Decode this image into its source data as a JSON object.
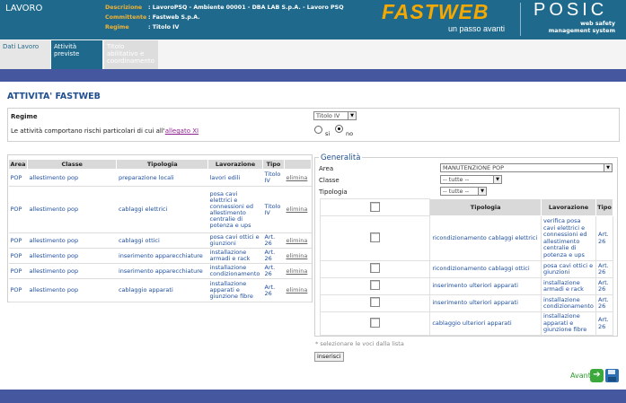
{
  "header": {
    "section_title": "LAVORO",
    "descrizione_label": "Descrizione",
    "descrizione_value": ": LavoroPSQ - Ambiente 00001 - DBA LAB S.p.A. - Lavoro PSQ",
    "committente_label": "Committente",
    "committente_value": ": Fastweb S.p.A.",
    "regime_label": "Regime",
    "regime_value": ": Titolo IV",
    "brand_logo": "FASTWEB",
    "brand_tagline": "un passo avanti",
    "product_logo": "POSIC",
    "product_tagline_1": "web safety",
    "product_tagline_2": "management system"
  },
  "tabs": [
    {
      "label": "Dati Lavoro"
    },
    {
      "label": "Attività previste"
    },
    {
      "label": "Titolo abilitativo e coordinamento"
    }
  ],
  "page": {
    "title": "ATTIVITA' FASTWEB",
    "regime_label": "Regime",
    "regime_select": "Titolo IV",
    "allegato_text": "Le attività comportano rischi particolari di cui all'",
    "allegato_link": "allegato XI",
    "radio_si": "si",
    "radio_no": "no"
  },
  "left_table": {
    "headers": [
      "Area",
      "Classe",
      "Tipologia",
      "Lavorazione",
      "Tipo",
      ""
    ],
    "rows": [
      {
        "area": "POP",
        "classe": "allestimento pop",
        "tipologia": "preparazione locali",
        "lavorazione": "lavori edili",
        "tipo": "Titolo IV",
        "action": "elimina"
      },
      {
        "area": "POP",
        "classe": "allestimento pop",
        "tipologia": "cablaggi elettrici",
        "lavorazione": "posa cavi elettrici e connessioni ed allestimento centralie di potenza e ups",
        "tipo": "Titolo IV",
        "action": "elimina"
      },
      {
        "area": "POP",
        "classe": "allestimento pop",
        "tipologia": "cablaggi ottici",
        "lavorazione": "posa cavi ottici e giunzioni",
        "tipo": "Art. 26",
        "action": "elimina"
      },
      {
        "area": "POP",
        "classe": "allestimento pop",
        "tipologia": "inserimento apparecchiature",
        "lavorazione": "installazione armadi e rack",
        "tipo": "Art. 26",
        "action": "elimina"
      },
      {
        "area": "POP",
        "classe": "allestimento pop",
        "tipologia": "inserimento apparecchiature",
        "lavorazione": "installazione condizionamento",
        "tipo": "Art. 26",
        "action": "elimina"
      },
      {
        "area": "POP",
        "classe": "allestimento pop",
        "tipologia": "cablaggio apparati",
        "lavorazione": "installazione apparati e giunzione fibre",
        "tipo": "Art. 26",
        "action": "elimina"
      }
    ]
  },
  "generalita": {
    "title": "Generalità",
    "area_label": "Area",
    "area_value": "MANUTENZIONE POP",
    "classe_label": "Classe",
    "classe_value": "-- tutte --",
    "tipologia_label": "Tipologia",
    "tipologia_value": "-- tutte --",
    "table_headers": [
      "",
      "Tipologia",
      "Lavorazione",
      "Tipo"
    ],
    "rows": [
      {
        "tipologia": "ricondizionamento cablaggi elettrici",
        "lavorazione": "verifica posa cavi elettrici e connessioni ed allestimento centralie di potenza e ups",
        "tipo": "Art. 26"
      },
      {
        "tipologia": "ricondizionamento cablaggi ottici",
        "lavorazione": "posa cavi ottici e giunzioni",
        "tipo": "Art. 26"
      },
      {
        "tipologia": "inserimento ulteriori apparati",
        "lavorazione": "installazione armadi e rack",
        "tipo": "Art. 26"
      },
      {
        "tipologia": "inserimento ulteriori apparati",
        "lavorazione": "installazione condizionamento",
        "tipo": "Art. 26"
      },
      {
        "tipologia": "cablaggio ulteriori apparati",
        "lavorazione": "installazione apparati e giunzione fibre",
        "tipo": "Art. 26"
      }
    ],
    "note": "* selezionare le voci dalla lista",
    "insert_button": "inserisci"
  },
  "footer": {
    "next_label": "Avanti"
  },
  "colors": {
    "header_bg": "#1f6a8c",
    "accent_bar": "#44579f",
    "brand_orange": "#f5a800",
    "link_blue": "#1f4fa0"
  }
}
